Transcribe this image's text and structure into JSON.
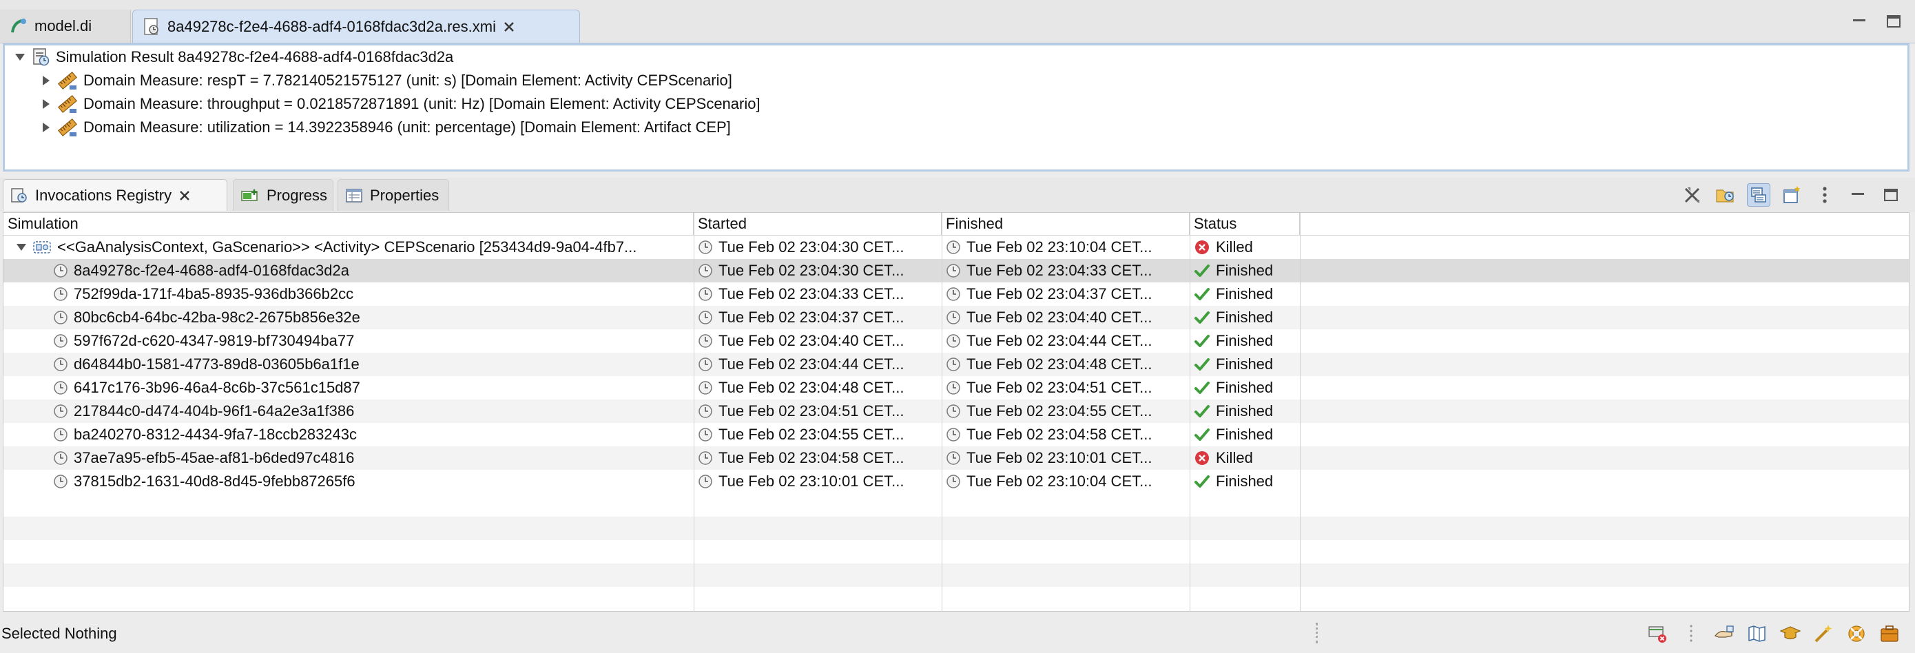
{
  "editor": {
    "tabs": [
      {
        "label": "model.di",
        "icon": "model-di-icon"
      },
      {
        "label": "8a49278c-f2e4-4688-adf4-0168fdac3d2a.res.xmi",
        "icon": "result-file-icon"
      }
    ],
    "tree": {
      "root": "Simulation Result 8a49278c-f2e4-4688-adf4-0168fdac3d2a",
      "children": [
        "Domain Measure: respT = 7.782140521575127 (unit: s) [Domain Element: Activity CEPScenario]",
        "Domain Measure: throughput = 0.0218572871891 (unit: Hz) [Domain Element: Activity CEPScenario]",
        "Domain Measure: utilization = 14.3922358946 (unit: percentage) [Domain Element: Artifact CEP]"
      ]
    }
  },
  "views": {
    "tabs": [
      {
        "label": "Invocations Registry",
        "icon": "registry-icon"
      },
      {
        "label": "Progress",
        "icon": "progress-icon"
      },
      {
        "label": "Properties",
        "icon": "properties-icon"
      }
    ]
  },
  "table": {
    "columns": [
      "Simulation",
      "Started",
      "Finished",
      "Status"
    ],
    "parent": {
      "simulation": "<<GaAnalysisContext, GaScenario>> <Activity> CEPScenario [253434d9-9a04-4fb7...",
      "started": "Tue Feb 02 23:04:30 CET...",
      "finished": "Tue Feb 02 23:10:04 CET...",
      "status": "Killed"
    },
    "rows": [
      {
        "simulation": "8a49278c-f2e4-4688-adf4-0168fdac3d2a",
        "started": "Tue Feb 02 23:04:30 CET...",
        "finished": "Tue Feb 02 23:04:33 CET...",
        "status": "Finished"
      },
      {
        "simulation": "752f99da-171f-4ba5-8935-936db366b2cc",
        "started": "Tue Feb 02 23:04:33 CET...",
        "finished": "Tue Feb 02 23:04:37 CET...",
        "status": "Finished"
      },
      {
        "simulation": "80bc6cb4-64bc-42ba-98c2-2675b856e32e",
        "started": "Tue Feb 02 23:04:37 CET...",
        "finished": "Tue Feb 02 23:04:40 CET...",
        "status": "Finished"
      },
      {
        "simulation": "597f672d-c620-4347-9819-bf730494ba77",
        "started": "Tue Feb 02 23:04:40 CET...",
        "finished": "Tue Feb 02 23:04:44 CET...",
        "status": "Finished"
      },
      {
        "simulation": "d64844b0-1581-4773-89d8-03605b6a1f1e",
        "started": "Tue Feb 02 23:04:44 CET...",
        "finished": "Tue Feb 02 23:04:48 CET...",
        "status": "Finished"
      },
      {
        "simulation": "6417c176-3b96-46a4-8c6b-37c561c15d87",
        "started": "Tue Feb 02 23:04:48 CET...",
        "finished": "Tue Feb 02 23:04:51 CET...",
        "status": "Finished"
      },
      {
        "simulation": "217844c0-d474-404b-96f1-64a2e3a1f386",
        "started": "Tue Feb 02 23:04:51 CET...",
        "finished": "Tue Feb 02 23:04:55 CET...",
        "status": "Finished"
      },
      {
        "simulation": "ba240270-8312-4434-9fa7-18ccb283243c",
        "started": "Tue Feb 02 23:04:55 CET...",
        "finished": "Tue Feb 02 23:04:58 CET...",
        "status": "Finished"
      },
      {
        "simulation": "37ae7a95-efb5-45ae-af81-b6ded97c4816",
        "started": "Tue Feb 02 23:04:58 CET...",
        "finished": "Tue Feb 02 23:10:01 CET...",
        "status": "Killed"
      },
      {
        "simulation": "37815db2-1631-40d8-8d45-9febb87265f6",
        "started": "Tue Feb 02 23:10:01 CET...",
        "finished": "Tue Feb 02 23:10:04 CET...",
        "status": "Finished"
      }
    ]
  },
  "status_bar": {
    "text": "Selected Nothing"
  },
  "colors": {
    "selection": "#d7e4f5",
    "killed": "#d9363e",
    "finished": "#3f9e3b"
  }
}
